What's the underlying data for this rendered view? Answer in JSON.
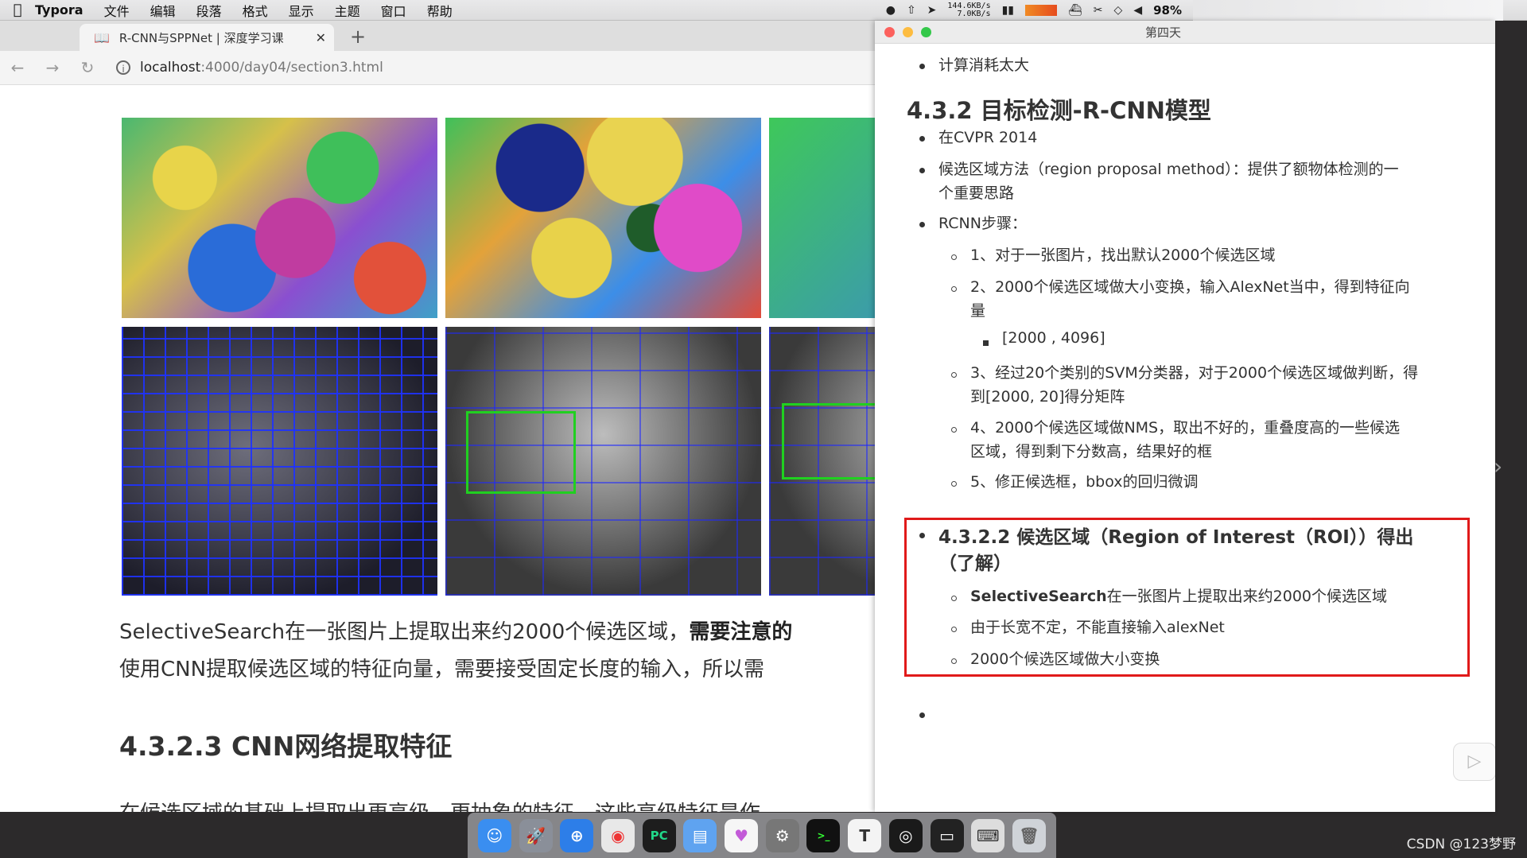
{
  "menubar": {
    "apple": "",
    "app_name": "Typora",
    "items": [
      "文件",
      "编辑",
      "段落",
      "格式",
      "显示",
      "主题",
      "窗口",
      "帮助"
    ],
    "net_up": "144.6KB/s",
    "net_down": "7.0KB/s",
    "battery": "98%"
  },
  "browser": {
    "tab_title": "R-CNN与SPPNet | 深度学习课",
    "tab_close": "✕",
    "new_tab": "+",
    "url_host": "localhost",
    "url_rest": ":4000/day04/section3.html",
    "para_line1_normal": "SelectiveSearch在一张图片上提取出来约2000个候选区域，",
    "para_line1_bold": "需要注意的",
    "para_line2": "使用CNN提取候选区域的特征向量，需要接受固定长度的输入，所以需",
    "heading": "4.3.2.3 CNN网络提取特征",
    "para_line3": "在候选区域的基础上提取出更高级、更抽象的特征，这些高级特征是作"
  },
  "typora": {
    "window_title": "第四天",
    "top_bullet": "计算消耗太大",
    "h2": "4.3.2 目标检测-R-CNN模型",
    "bullets": {
      "cvpr": "在CVPR 2014",
      "rpm_line1": "候选区域方法（region proposal method）：提供了额物体检测的一",
      "rpm_line2": "个重要思路",
      "rcnn": "RCNN步骤："
    },
    "steps": {
      "s1": "1、对于一张图片，找出默认2000个候选区域",
      "s2_line1": "2、2000个候选区域做大小变换，输入AlexNet当中，得到特征向",
      "s2_line2": "量",
      "s2_sub": "[2000 , 4096]",
      "s3_line1": "3、经过20个类别的SVM分类器，对于2000个候选区域做判断，得",
      "s3_line2": "到[2000, 20]得分矩阵",
      "s4_line1": "4、2000个候选区域做NMS，取出不好的，重叠度高的一些候选",
      "s4_line2": "区域，得到剩下分数高，结果好的框",
      "s5": "5、修正候选框，bbox的回归微调"
    },
    "highlight": {
      "title_line1": "4.3.2.2 候选区域（Region of Interest（ROI））得出",
      "title_line2": "（了解）",
      "item1_bold": "SelectiveSearch",
      "item1_rest": "在一张图片上提取出来约2000个候选区域",
      "item2": "由于长宽不定，不能直接输入alexNet",
      "item3": "2000个候选区域做大小变换"
    }
  },
  "watermark": "CSDN @123梦野",
  "colors": {
    "highlight_border": "#e01a1a",
    "green_box": "#20d020",
    "blue_boxes": "#1e32ff"
  }
}
